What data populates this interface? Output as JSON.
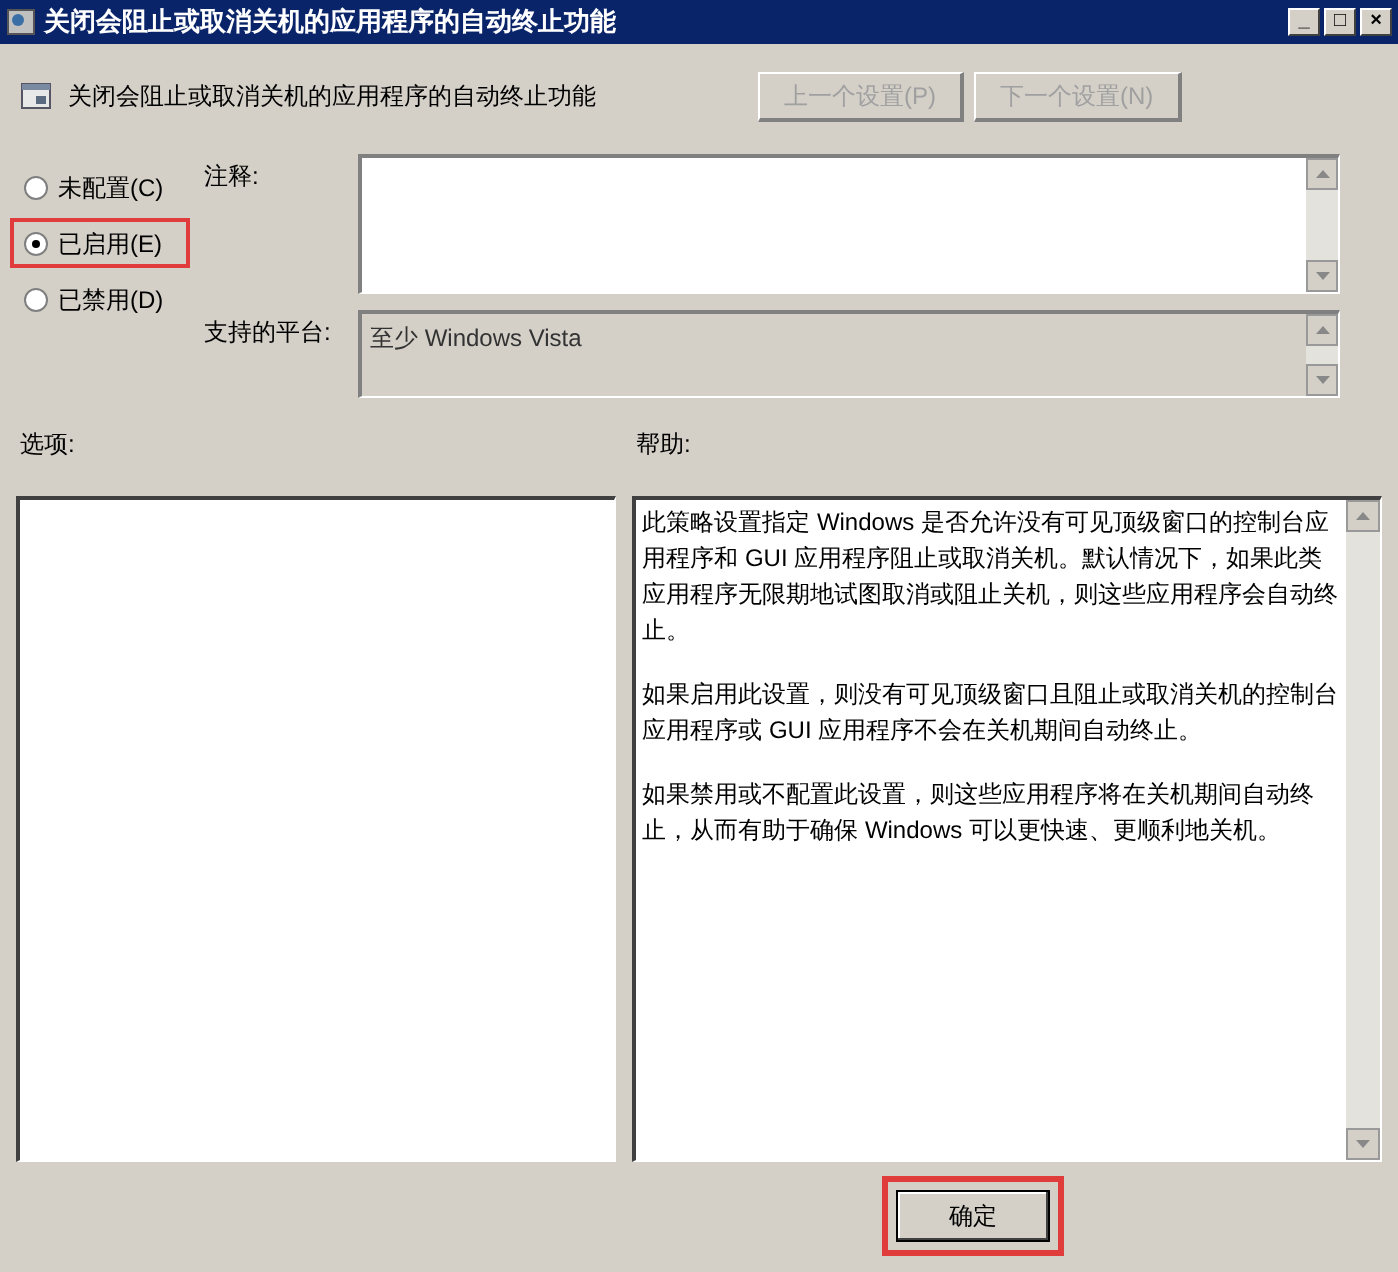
{
  "window": {
    "title": "关闭会阻止或取消关机的应用程序的自动终止功能",
    "controls": [
      "_",
      "□",
      "×"
    ]
  },
  "header": {
    "title": "关闭会阻止或取消关机的应用程序的自动终止功能",
    "buttons": [
      {
        "label": "上一个设置(P)",
        "disabled": true
      },
      {
        "label": "下一个设置(N)",
        "disabled": true
      }
    ]
  },
  "options": [
    {
      "label": "未配置(C)",
      "selected": false,
      "highlighted": false
    },
    {
      "label": "已启用(E)",
      "selected": true,
      "highlighted": true
    },
    {
      "label": "已禁用(D)",
      "selected": false,
      "highlighted": false
    }
  ],
  "comment": {
    "label": "注释:"
  },
  "platform": {
    "label": "支持的平台:",
    "value": "至少 Windows Vista"
  },
  "options_pane": {
    "label": "选项:"
  },
  "help": {
    "label": "帮助:",
    "paragraphs": [
      "此策略设置指定 Windows 是否允许没有可见顶级窗口的控制台应用程序和 GUI 应用程序阻止或取消关机。默认情况下，如果此类应用程序无限期地试图取消或阻止关机，则这些应用程序会自动终止。",
      "如果启用此设置，则没有可见顶级窗口且阻止或取消关机的控制台应用程序或 GUI 应用程序不会在关机期间自动终止。",
      "如果禁用或不配置此设置，则这些应用程序将在关机期间自动终止，从而有助于确保 Windows 可以更快速、更顺利地关机。"
    ]
  },
  "footer": {
    "buttons": [
      {
        "label": "确定",
        "highlighted": true
      }
    ]
  }
}
